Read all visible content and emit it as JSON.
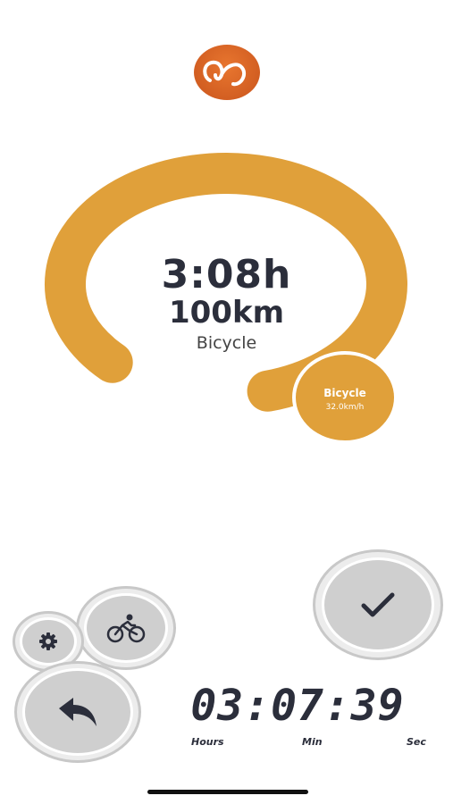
{
  "summary": {
    "duration": "3:08h",
    "distance": "100km",
    "activity": "Bicycle"
  },
  "progress": {
    "fraction": 0.8,
    "color": "#e0a03a"
  },
  "speed_bubble": {
    "mode": "Bicycle",
    "speed": "32.0km/h"
  },
  "timer": {
    "value": "03:07:39",
    "hours_label": "Hours",
    "min_label": "Min",
    "sec_label": "Sec"
  },
  "icons": {
    "logo": "brand-logo-icon",
    "finish": "checkmark-icon",
    "activity": "bicycle-icon",
    "settings": "gear-icon",
    "back": "undo-arrow-icon"
  },
  "colors": {
    "accent": "#e0a03a",
    "logo": "#d9662a",
    "text": "#2b2e3b"
  }
}
